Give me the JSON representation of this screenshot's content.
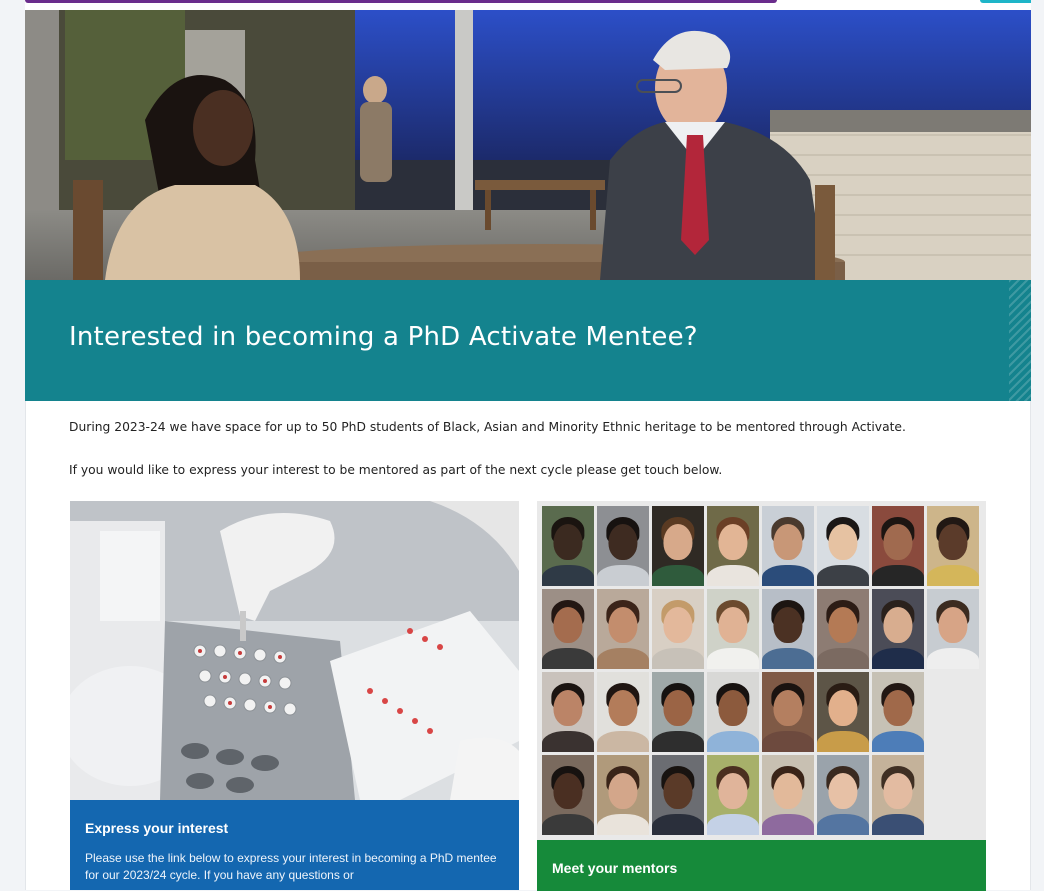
{
  "banner": {
    "title": "Interested in becoming a PhD Activate Mentee?"
  },
  "intro": {
    "paragraph_1": "During 2023-24 we have space for up to 50 PhD students of Black, Asian and Minority Ethnic heritage to be mentored through Activate.",
    "paragraph_2": "If you would like to express your interest to be mentored as part of the next cycle please get touch below."
  },
  "cards": {
    "express": {
      "title": "Express your interest",
      "body": "Please use the link below to express your interest in becoming a PhD mentee for our 2023/24 cycle. If you have any questions or"
    },
    "mentors": {
      "title": "Meet your mentors"
    }
  },
  "colors": {
    "banner": "#14838e",
    "express_caption": "#1467b0",
    "mentors_caption": "#168a3a",
    "top_accent_purple": "#6a2c8c",
    "top_accent_teal": "#1eb5c8"
  },
  "mentor_tiles": [
    {
      "bg": "#5a6b4e",
      "skin": "#3b2a20",
      "hair": "#1a1410",
      "body": "#2f3a46"
    },
    {
      "bg": "#8d8f93",
      "skin": "#3e2b21",
      "hair": "#171210",
      "body": "#c9cdd2"
    },
    {
      "bg": "#2f2a24",
      "skin": "#d7a98a",
      "hair": "#5a3a22",
      "body": "#2f5b3c"
    },
    {
      "bg": "#6f6a48",
      "skin": "#e2b595",
      "hair": "#6b3f26",
      "body": "#e9e4de"
    },
    {
      "bg": "#c9cfd6",
      "skin": "#c89777",
      "hair": "#4a3a2e",
      "body": "#2b4c7a"
    },
    {
      "bg": "#d8dde2",
      "skin": "#e6c2a2",
      "hair": "#1b1716",
      "body": "#3c4046"
    },
    {
      "bg": "#8a4a3d",
      "skin": "#a06a4f",
      "hair": "#1c1512",
      "body": "#262626"
    },
    {
      "bg": "#cdb58a",
      "skin": "#5b3b2a",
      "hair": "#211814",
      "body": "#d4b65a"
    },
    {
      "bg": "#9c8f86",
      "skin": "#a46c4e",
      "hair": "#231713",
      "body": "#3a3a3a"
    },
    {
      "bg": "#b9a99a",
      "skin": "#c38d6d",
      "hair": "#3b2419",
      "body": "#a58062"
    },
    {
      "bg": "#d8cfc4",
      "skin": "#e3b89b",
      "hair": "#c39b6a",
      "body": "#c7c1b8"
    },
    {
      "bg": "#cfd2c8",
      "skin": "#e0b294",
      "hair": "#6b4a2e",
      "body": "#f1f1ee"
    },
    {
      "bg": "#b7bec7",
      "skin": "#4b3123",
      "hair": "#1c1512",
      "body": "#4c6d93"
    },
    {
      "bg": "#8d7c73",
      "skin": "#b47a55",
      "hair": "#2c1c15",
      "body": "#7b6a61"
    },
    {
      "bg": "#4b4c57",
      "skin": "#d8ad8f",
      "hair": "#2a211c",
      "body": "#1f2d4a"
    },
    {
      "bg": "#c7ccd1",
      "skin": "#d7a486",
      "hair": "#3c2b20",
      "body": "#eeeeee"
    },
    {
      "bg": "#c9c2bc",
      "skin": "#bb8467",
      "hair": "#1b1411",
      "body": "#3a3230"
    },
    {
      "bg": "#e1e0dc",
      "skin": "#b37c5a",
      "hair": "#201612",
      "body": "#cbb7a3"
    },
    {
      "bg": "#9fa8a8",
      "skin": "#9b6445",
      "hair": "#161210",
      "body": "#2e2e2e"
    },
    {
      "bg": "#d8d8d6",
      "skin": "#8c5a3d",
      "hair": "#171210",
      "body": "#8fb3d9"
    },
    {
      "bg": "#7f5a46",
      "skin": "#b47f60",
      "hair": "#1a1310",
      "body": "#6d4a3e"
    },
    {
      "bg": "#5d5547",
      "skin": "#e2b08c",
      "hair": "#2a1c14",
      "body": "#c89c49"
    },
    {
      "bg": "#c6c1b5",
      "skin": "#a0694a",
      "hair": "#221713",
      "body": "#4d7db8"
    },
    {
      "bg": "empty"
    },
    {
      "bg": "#7a6a5e",
      "skin": "#4a2f22",
      "hair": "#171210",
      "body": "#3a3a3a"
    },
    {
      "bg": "#b09a7b",
      "skin": "#d3a68a",
      "hair": "#3a2418",
      "body": "#e9e3db"
    },
    {
      "bg": "#6b6d72",
      "skin": "#5a3a28",
      "hair": "#181310",
      "body": "#2a2f3b"
    },
    {
      "bg": "#a7b06a",
      "skin": "#e0b49a",
      "hair": "#4b2f20",
      "body": "#c4d1e6"
    },
    {
      "bg": "#c8c0b2",
      "skin": "#e2b99a",
      "hair": "#3a2418",
      "body": "#8e6a9e"
    },
    {
      "bg": "#9aa3ab",
      "skin": "#e7c1a6",
      "hair": "#3a2a20",
      "body": "#5475a1"
    },
    {
      "bg": "#c4b29a",
      "skin": "#e3bba1",
      "hair": "#3f2f23",
      "body": "#3a4f74"
    },
    {
      "bg": "empty"
    }
  ]
}
